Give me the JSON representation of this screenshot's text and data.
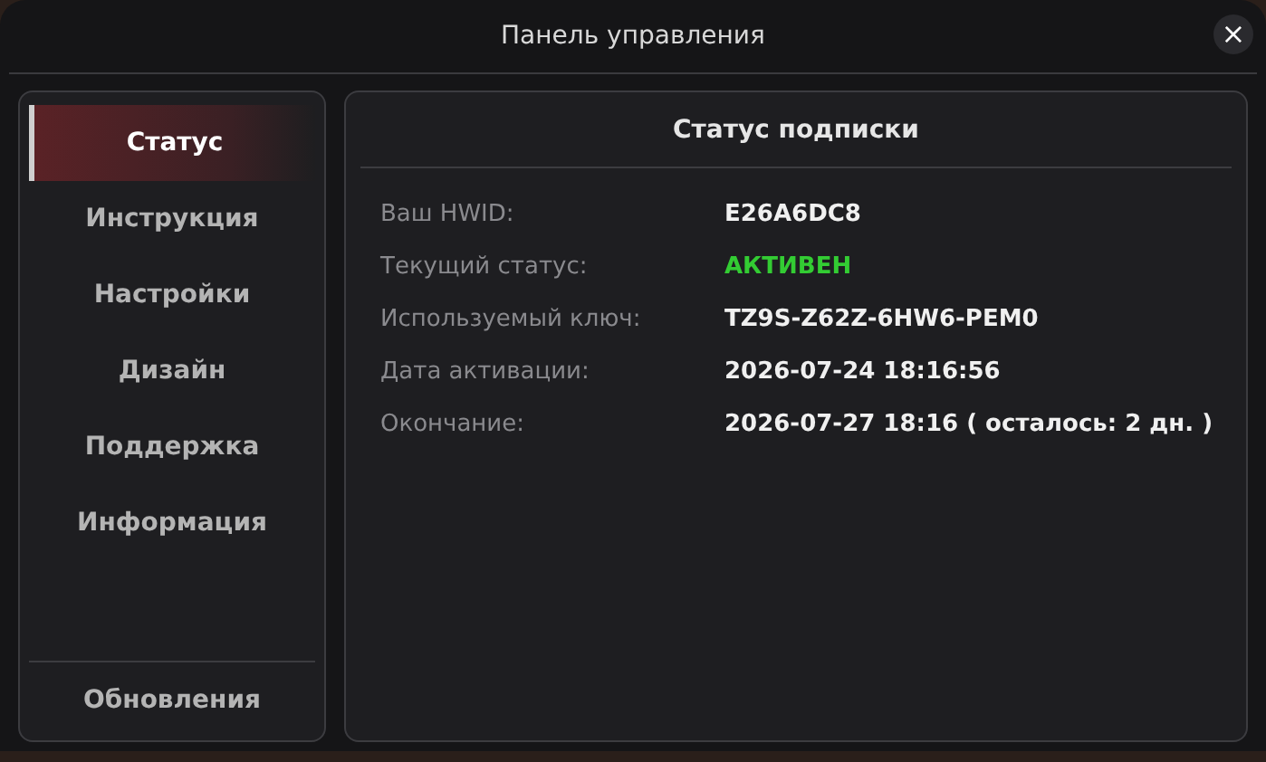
{
  "window": {
    "title": "Панель управления",
    "close": "×"
  },
  "sidebar": {
    "items": [
      {
        "label": "Статус",
        "selected": true
      },
      {
        "label": "Инструкция",
        "selected": false
      },
      {
        "label": "Настройки",
        "selected": false
      },
      {
        "label": "Дизайн",
        "selected": false
      },
      {
        "label": "Поддержка",
        "selected": false
      },
      {
        "label": "Информация",
        "selected": false
      }
    ],
    "footer": {
      "label": "Обновления",
      "selected": false
    }
  },
  "panel": {
    "title": "Статус подписки",
    "rows": [
      {
        "label": "Ваш HWID:",
        "value": "E26A6DC8",
        "color": "#f0f0f0"
      },
      {
        "label": "Текущий статус:",
        "value": "АКТИВЕН",
        "color": "#33cc33"
      },
      {
        "label": "Используемый ключ:",
        "value": "TZ9S-Z62Z-6HW6-PEM0",
        "color": "#f0f0f0"
      },
      {
        "label": "Дата активации:",
        "value": "2026-07-24 18:16:56",
        "color": "#f0f0f0"
      },
      {
        "label": "Окончание:",
        "value": "2026-07-27 18:16 ( осталось: 2 дн. )",
        "color": "#f0f0f0"
      }
    ]
  }
}
